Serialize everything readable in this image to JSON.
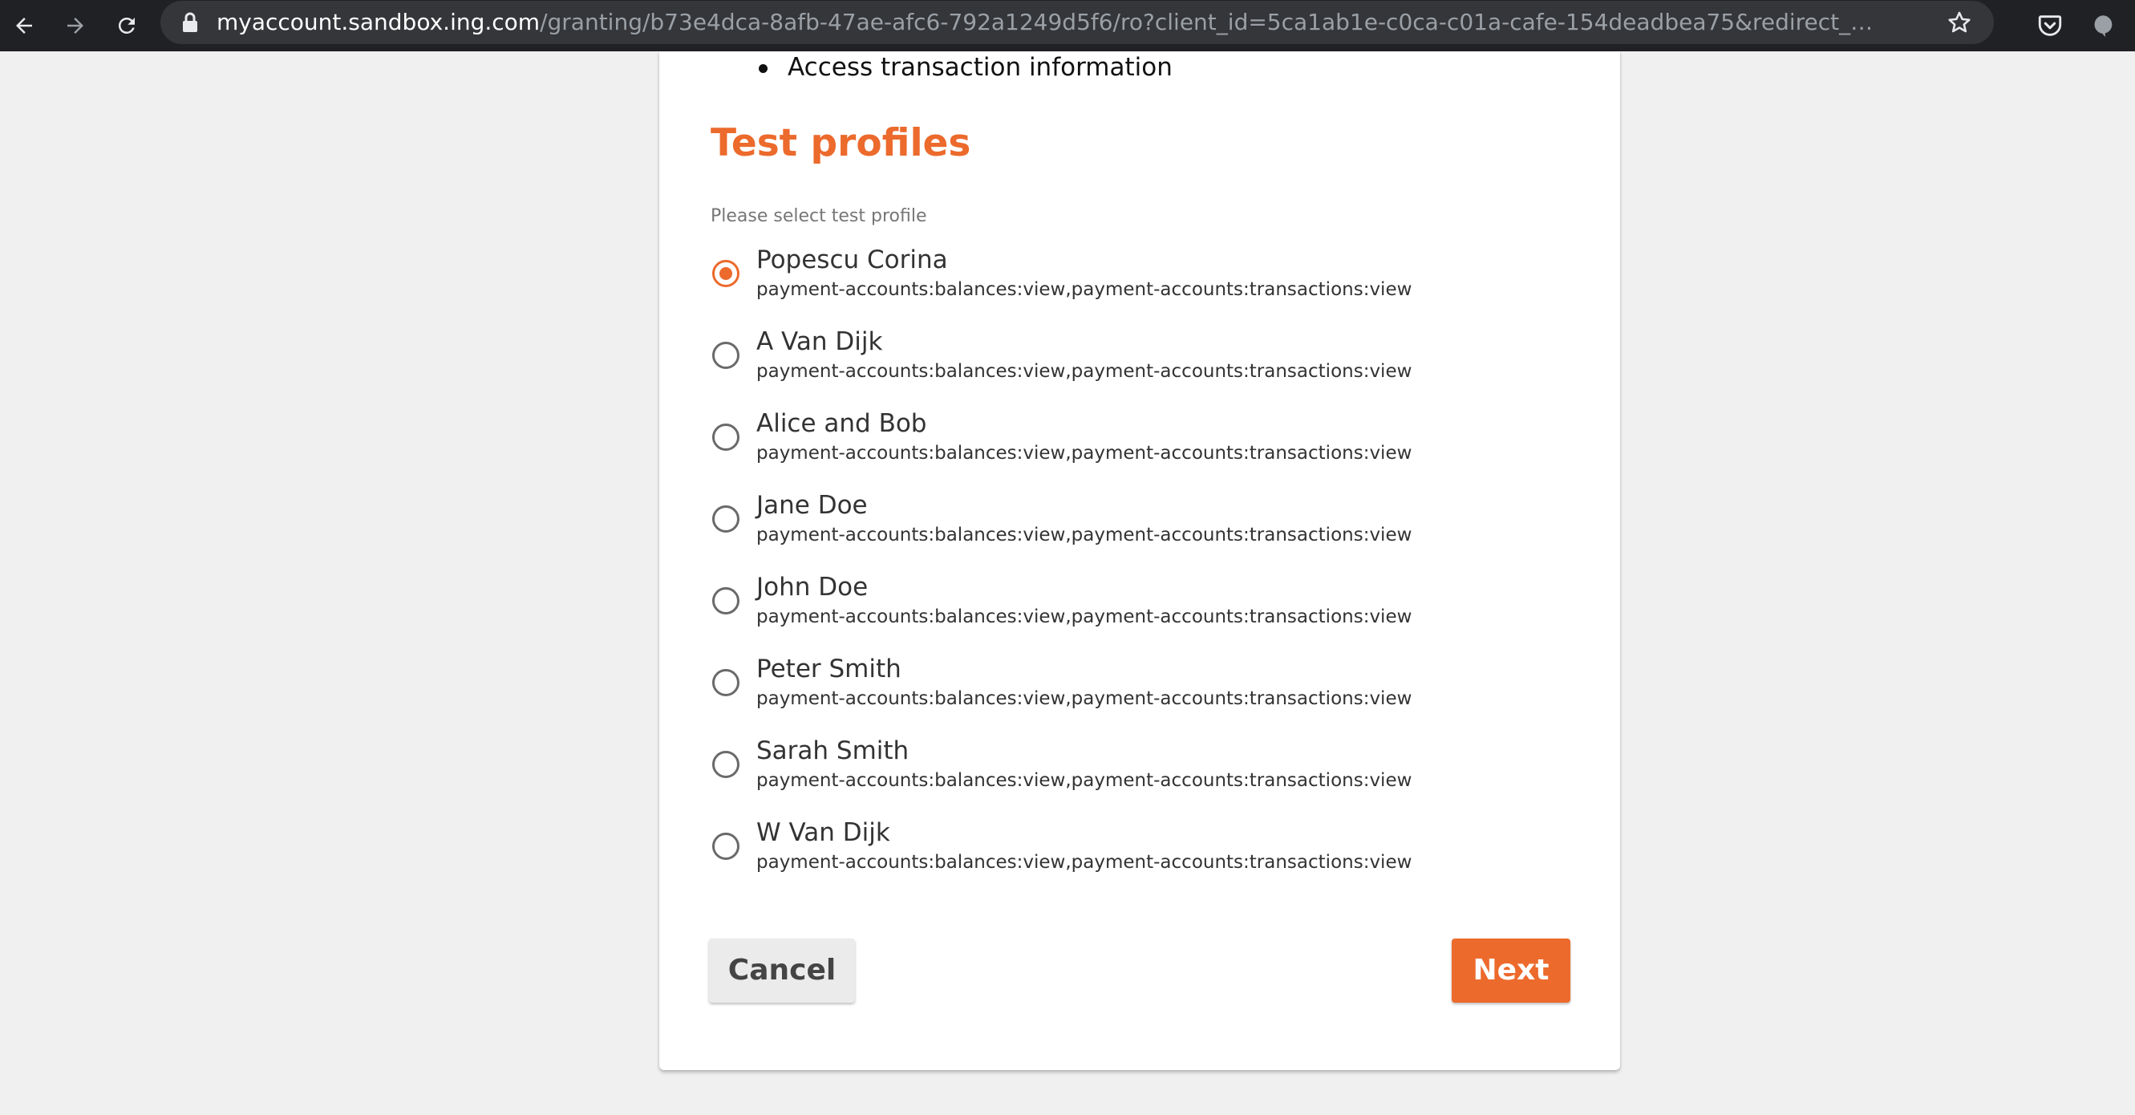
{
  "browser": {
    "url_host": "myaccount.sandbox.ing.com",
    "url_path": "/granting/b73e4dca-8afb-47ae-afc6-792a1249d5f6/ro?client_id=5ca1ab1e-c0ca-c01a-cafe-154deadbea75&redirect_uri=https://exa..."
  },
  "consent": {
    "bullet": "Access transaction information"
  },
  "test_profiles": {
    "title": "Test profiles",
    "select_label": "Please select test profile",
    "selected_index": 0,
    "items": [
      {
        "name": "Popescu Corina",
        "scope": "payment-accounts:balances:view,payment-accounts:transactions:view"
      },
      {
        "name": "A Van Dijk",
        "scope": "payment-accounts:balances:view,payment-accounts:transactions:view"
      },
      {
        "name": "Alice and Bob",
        "scope": "payment-accounts:balances:view,payment-accounts:transactions:view"
      },
      {
        "name": "Jane Doe",
        "scope": "payment-accounts:balances:view,payment-accounts:transactions:view"
      },
      {
        "name": "John Doe",
        "scope": "payment-accounts:balances:view,payment-accounts:transactions:view"
      },
      {
        "name": "Peter Smith",
        "scope": "payment-accounts:balances:view,payment-accounts:transactions:view"
      },
      {
        "name": "Sarah Smith",
        "scope": "payment-accounts:balances:view,payment-accounts:transactions:view"
      },
      {
        "name": "W Van Dijk",
        "scope": "payment-accounts:balances:view,payment-accounts:transactions:view"
      }
    ]
  },
  "actions": {
    "cancel_label": "Cancel",
    "next_label": "Next"
  },
  "colors": {
    "accent": "#ec6a2c",
    "chrome_bg": "#202124",
    "page_bg": "#f0f0f0"
  }
}
